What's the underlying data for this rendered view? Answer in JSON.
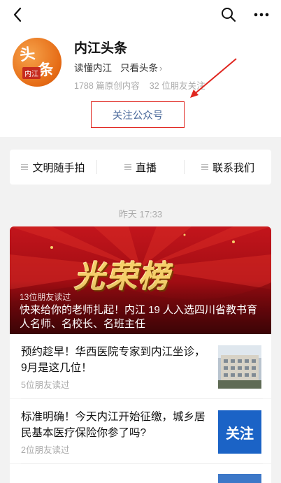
{
  "account": {
    "name": "内江头条",
    "tagline_1": "读懂内江",
    "tagline_2": "只看头条",
    "original_count": "1788 篇原创内容",
    "friends_follow": "32 位朋友关注",
    "follow_button": "关注公众号",
    "avatar_text_1": "头",
    "avatar_text_2": "条",
    "avatar_text_3": "内江"
  },
  "menu": [
    {
      "label": "文明随手拍"
    },
    {
      "label": "直播"
    },
    {
      "label": "联系我们"
    }
  ],
  "feed": {
    "date": "昨天 17:33",
    "hero": {
      "banner": "光荣榜",
      "reads": "13位朋友读过",
      "title": "快来给你的老师扎起！内江 19 人入选四川省教书育人名师、名校长、名班主任"
    },
    "articles": [
      {
        "title": "预约趁早！华西医院专家到内江坐诊，9月是这几位！",
        "reads": "5位朋友读过",
        "thumb_text": ""
      },
      {
        "title": "标准明确！今天内江开始征缴，城乡居民基本医疗保险你参了吗?",
        "reads": "2位朋友读过",
        "thumb_text": "关注"
      }
    ]
  },
  "colors": {
    "accent_link": "#4b6a9b",
    "annotation_red": "#e0261f",
    "hero_red": "#c3151c",
    "thumb_blue": "#1b63c6"
  },
  "icons": [
    "back-icon",
    "search-icon",
    "more-icon",
    "chevron-right-icon",
    "menu-lines-icon"
  ]
}
